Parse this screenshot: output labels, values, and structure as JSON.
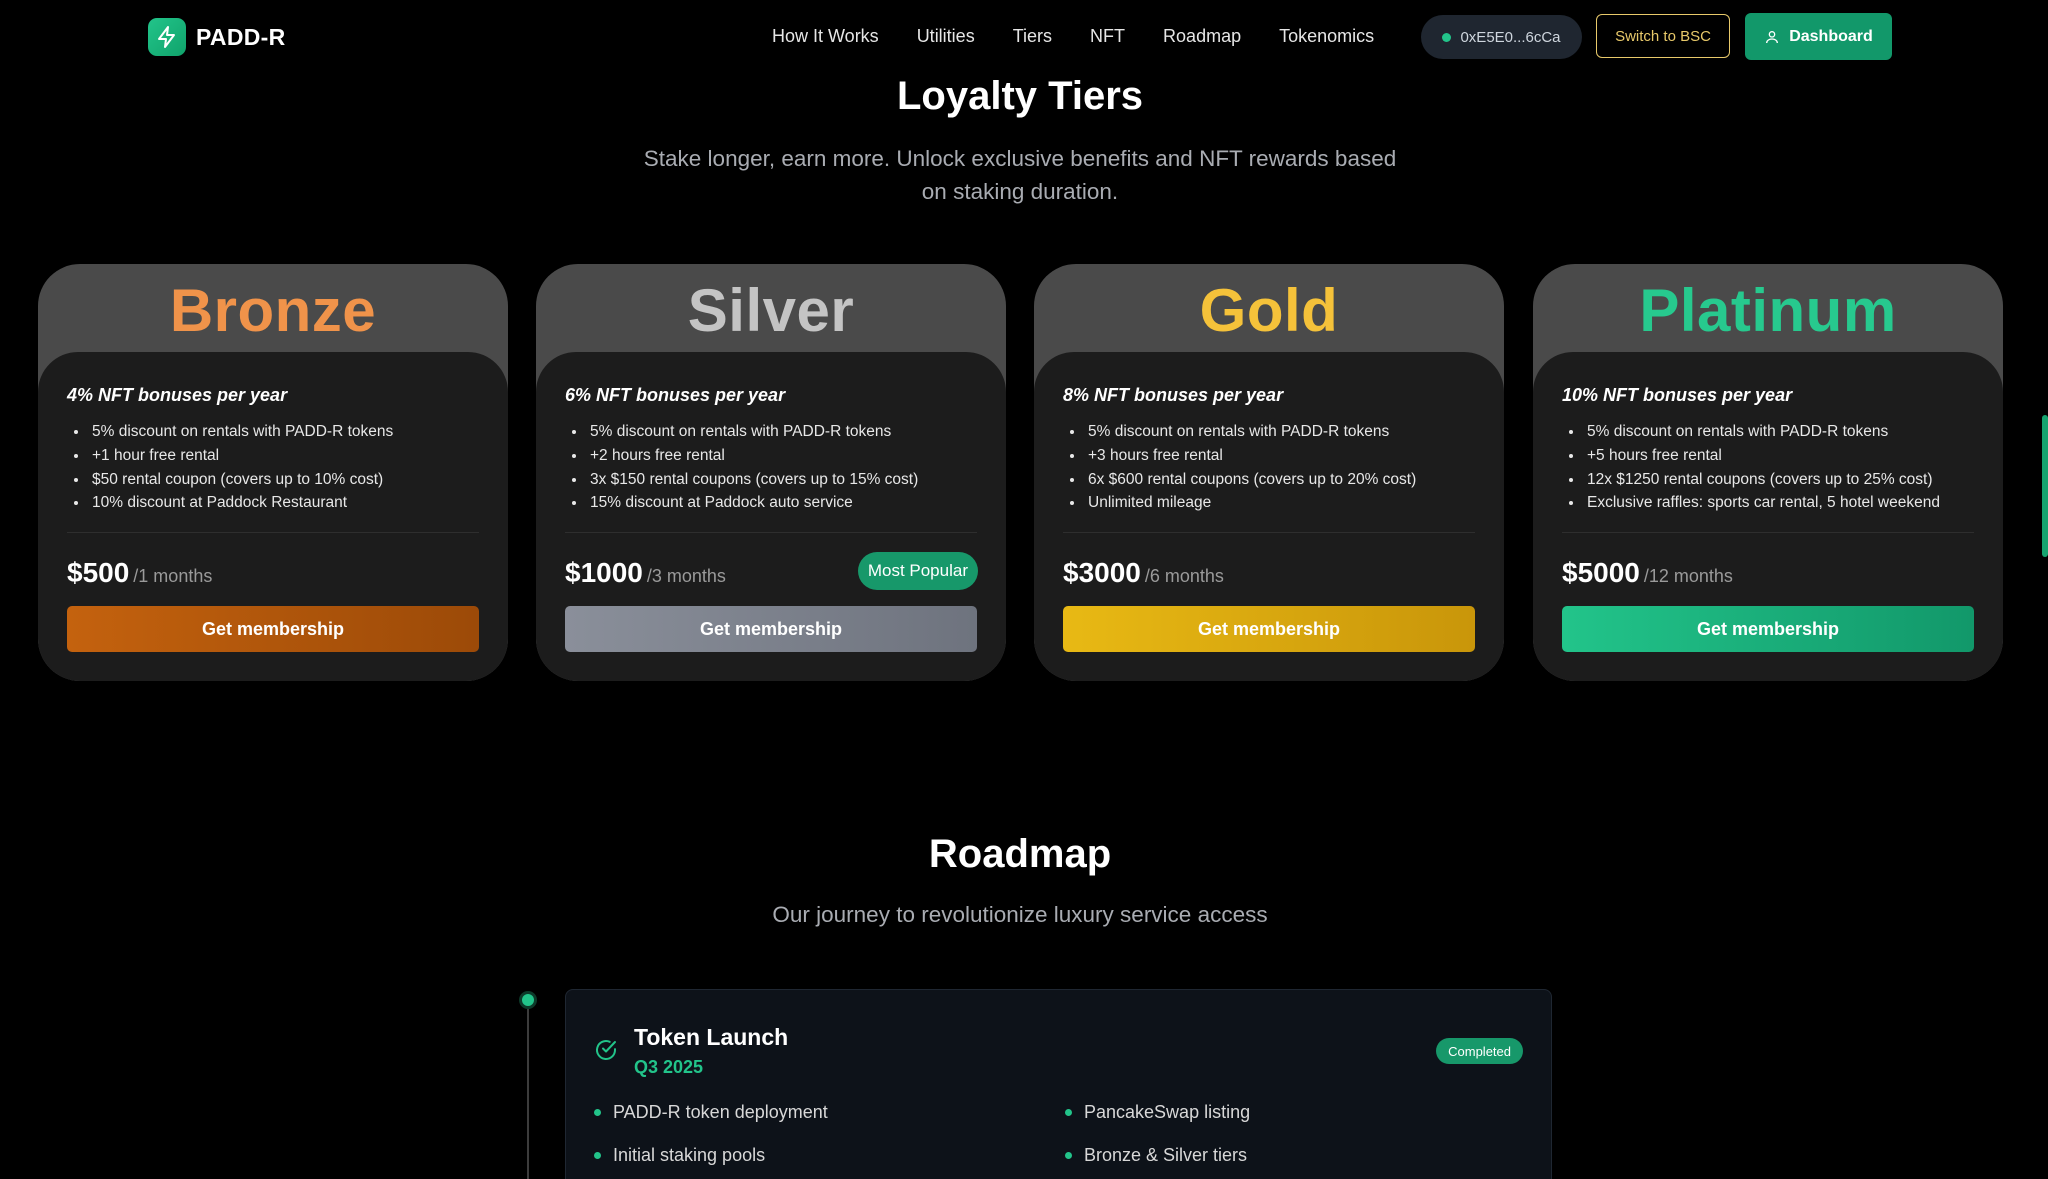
{
  "header": {
    "brand": "PADD-R",
    "nav": [
      "How It Works",
      "Utilities",
      "Tiers",
      "NFT",
      "Roadmap",
      "Tokenomics"
    ],
    "wallet": "0xE5E0...6cCa",
    "switch_label": "Switch to BSC",
    "dashboard_label": "Dashboard"
  },
  "tiers_section": {
    "title": "Loyalty Tiers",
    "subtitle_line1": "Stake longer, earn more. Unlock exclusive benefits and NFT rewards based",
    "subtitle_line2": "on staking duration."
  },
  "tiers": [
    {
      "name": "Bronze",
      "color": "#f0934a",
      "bonus": "4% NFT bonuses per year",
      "benefits": [
        "5% discount on rentals with PADD-R tokens",
        "+1 hour free rental",
        "$50 rental coupon (covers up to 10% cost)",
        "10% discount at Paddock Restaurant"
      ],
      "price": "$500",
      "period": "/1 months",
      "button": "Get membership"
    },
    {
      "name": "Silver",
      "color": "#c4c4c4",
      "bonus": "6% NFT bonuses per year",
      "benefits": [
        "5% discount on rentals with PADD-R tokens",
        "+2 hours free rental",
        "3x $150 rental coupons (covers up to 15% cost)",
        "15% discount at Paddock auto service"
      ],
      "price": "$1000",
      "period": "/3 months",
      "badge": "Most Popular",
      "button": "Get membership"
    },
    {
      "name": "Gold",
      "color": "#f5c23a",
      "bonus": "8% NFT bonuses per year",
      "benefits": [
        "5% discount on rentals with PADD-R tokens",
        "+3 hours free rental",
        "6x $600 rental coupons (covers up to 20% cost)",
        "Unlimited mileage"
      ],
      "price": "$3000",
      "period": "/6 months",
      "button": "Get membership"
    },
    {
      "name": "Platinum",
      "color": "#27c98e",
      "bonus": "10% NFT bonuses per year",
      "benefits": [
        "5% discount on rentals with PADD-R tokens",
        "+5 hours free rental",
        "12x $1250 rental coupons (covers up to 25% cost)",
        "Exclusive raffles: sports car rental, 5 hotel weekend"
      ],
      "price": "$5000",
      "period": "/12 months",
      "button": "Get membership"
    }
  ],
  "roadmap_section": {
    "title": "Roadmap",
    "subtitle": "Our journey to revolutionize luxury service access"
  },
  "roadmap": {
    "title": "Token Launch",
    "quarter": "Q3 2025",
    "status": "Completed",
    "items": [
      "PADD-R token deployment",
      "PancakeSwap listing",
      "Initial staking pools",
      "Bronze & Silver tiers"
    ]
  }
}
